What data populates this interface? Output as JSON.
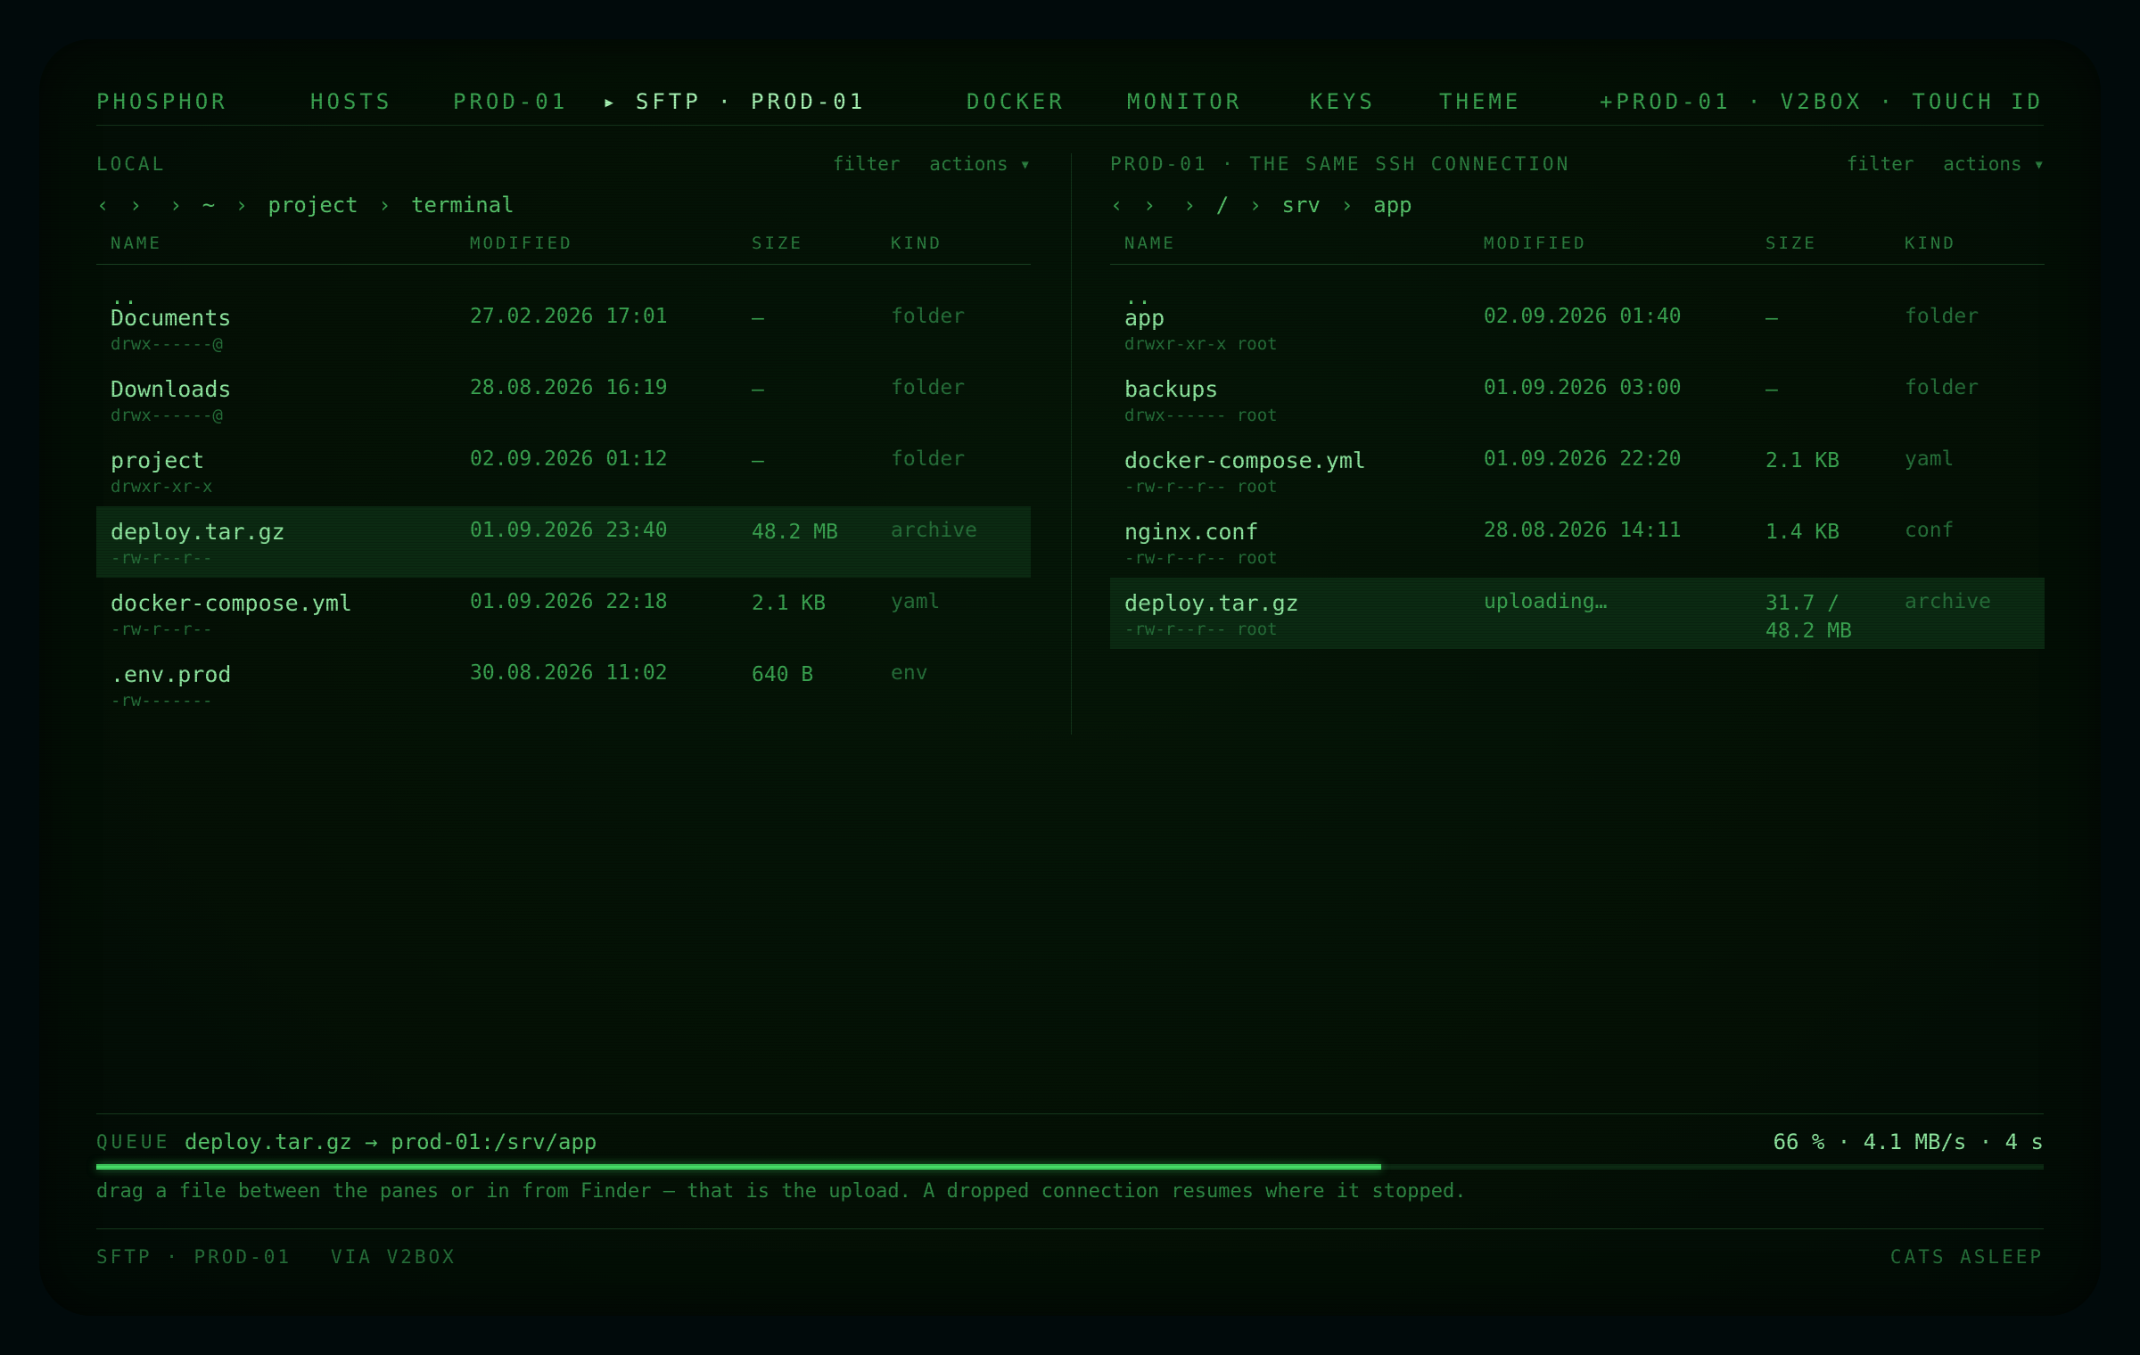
{
  "nav": {
    "brand": "PHOSPHOR",
    "items": [
      "HOSTS",
      "PROD-01",
      "▸ SFTP · PROD-01",
      "DOCKER",
      "MONITOR",
      "KEYS",
      "THEME",
      "+"
    ],
    "status": "PROD-01 · V2BOX · TOUCH ID"
  },
  "local": {
    "title": "LOCAL",
    "filter": "filter",
    "actions": "actions ▾",
    "crumbs": {
      "back": "‹",
      "forward": "›",
      "home": "~",
      "parts": [
        "project",
        "terminal"
      ]
    },
    "columns": [
      "NAME",
      "MODIFIED",
      "SIZE",
      "KIND"
    ],
    "rows": [
      {
        "name": "..",
        "perm": "",
        "modified": "",
        "size": "",
        "kind": ""
      },
      {
        "name": "Documents",
        "perm": "drwx------@",
        "modified": "27.02.2026 17:01",
        "size": "—",
        "kind": "folder"
      },
      {
        "name": "Downloads",
        "perm": "drwx------@",
        "modified": "28.08.2026 16:19",
        "size": "—",
        "kind": "folder"
      },
      {
        "name": "project",
        "perm": "drwxr-xr-x",
        "modified": "02.09.2026 01:12",
        "size": "—",
        "kind": "folder"
      },
      {
        "name": "deploy.tar.gz",
        "perm": "-rw-r--r--",
        "modified": "01.09.2026 23:40",
        "size": "48.2 MB",
        "kind": "archive",
        "selected": true
      },
      {
        "name": "docker-compose.yml",
        "perm": "-rw-r--r--",
        "modified": "01.09.2026 22:18",
        "size": "2.1 KB",
        "kind": "yaml"
      },
      {
        "name": ".env.prod",
        "perm": "-rw-------",
        "modified": "30.08.2026 11:02",
        "size": "640 B",
        "kind": "env"
      }
    ]
  },
  "remote": {
    "title": "PROD-01 · THE SAME SSH CONNECTION",
    "filter": "filter",
    "actions": "actions ▾",
    "crumbs": {
      "back": "‹",
      "forward": "›",
      "home": "/",
      "parts": [
        "srv",
        "app"
      ]
    },
    "columns": [
      "NAME",
      "MODIFIED",
      "SIZE",
      "KIND"
    ],
    "rows": [
      {
        "name": "..",
        "perm": "",
        "modified": "",
        "size": "",
        "kind": ""
      },
      {
        "name": "app",
        "perm": "drwxr-xr-x root",
        "modified": "02.09.2026 01:40",
        "size": "—",
        "kind": "folder"
      },
      {
        "name": "backups",
        "perm": "drwx------ root",
        "modified": "01.09.2026 03:00",
        "size": "—",
        "kind": "folder"
      },
      {
        "name": "docker-compose.yml",
        "perm": "-rw-r--r-- root",
        "modified": "01.09.2026 22:20",
        "size": "2.1 KB",
        "kind": "yaml"
      },
      {
        "name": "nginx.conf",
        "perm": "-rw-r--r-- root",
        "modified": "28.08.2026 14:11",
        "size": "1.4 KB",
        "kind": "conf"
      },
      {
        "name": "deploy.tar.gz",
        "perm": "-rw-r--r-- root",
        "modified": "uploading…",
        "size": "31.7 / 48.2 MB",
        "kind": "archive",
        "selected": true
      }
    ]
  },
  "queue": {
    "label": "QUEUE",
    "file": "deploy.tar.gz → prod-01:/srv/app",
    "stats": "66 % · 4.1 MB/s · 4 s",
    "progress": 0.66,
    "hint": "drag a file between the panes or in from Finder — that is the upload. A dropped connection resumes where it stopped."
  },
  "footer": {
    "left": "SFTP · PROD-01",
    "via": "VIA V2BOX",
    "right": "CATS ASLEEP"
  },
  "colors": {
    "accent": "#45dd66",
    "text_bright": "#8fe8a0",
    "text_mid": "#3aa451",
    "text_dim": "#26703a",
    "selected_row": "#0b2a12"
  }
}
